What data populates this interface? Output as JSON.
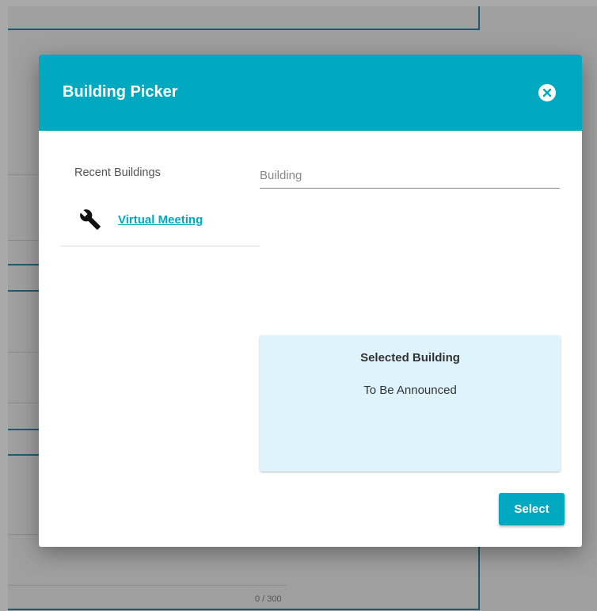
{
  "modal": {
    "title": "Building Picker",
    "recent": {
      "label": "Recent Buildings",
      "items": [
        {
          "label": "Virtual Meeting",
          "icon": "wrench-icon"
        }
      ]
    },
    "search": {
      "placeholder": "Building",
      "value": ""
    },
    "selected": {
      "title": "Selected Building",
      "value": "To Be Announced"
    },
    "select_label": "Select"
  },
  "background": {
    "char_counter": "0 / 300"
  },
  "colors": {
    "accent": "#00a8c0",
    "panel": "#def3fb",
    "overlay": "#a9a9a9"
  }
}
